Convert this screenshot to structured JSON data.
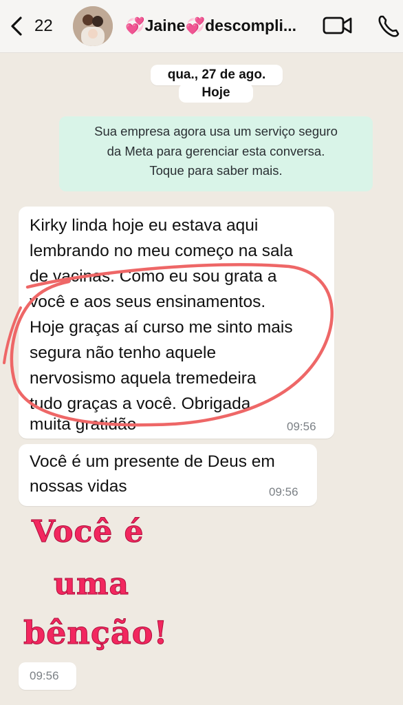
{
  "header": {
    "back_count": "22",
    "contact_name": "💞Jaine💞descompli...",
    "icons": [
      "chevron-left-icon",
      "video-camera-icon",
      "phone-icon"
    ]
  },
  "chat": {
    "date_label": "qua., 27 de ago.",
    "today_label": "Hoje",
    "notice_lines": [
      "Sua empresa agora usa um serviço seguro",
      "da Meta para gerenciar esta conversa.",
      "Toque para saber mais."
    ],
    "messages": [
      {
        "lines": [
          "Kirky linda hoje eu estava aqui",
          "lembrando no meu começo na sala",
          "de vacinas.  Como eu sou grata a",
          "você e aos seus ensinamentos.",
          "Hoje graças aí curso me sinto mais",
          "segura não tenho aquele",
          "nervosismo aquela tremedeira",
          "tudo graças a você. Obrigada",
          "muita gratidão"
        ],
        "time": "09:56"
      },
      {
        "lines": [
          "Você é um presente de Deus em",
          "nossas vidas"
        ],
        "time": "09:56"
      }
    ],
    "sticker_lines": [
      "Você é",
      "uma",
      "bênção!"
    ],
    "sticker_time": "09:56",
    "colors": {
      "background": "#efeae2",
      "notice_bg": "#d9f4e8",
      "highlight_ellipse": "#ee6767",
      "sticker_text": "#f2275f"
    }
  }
}
